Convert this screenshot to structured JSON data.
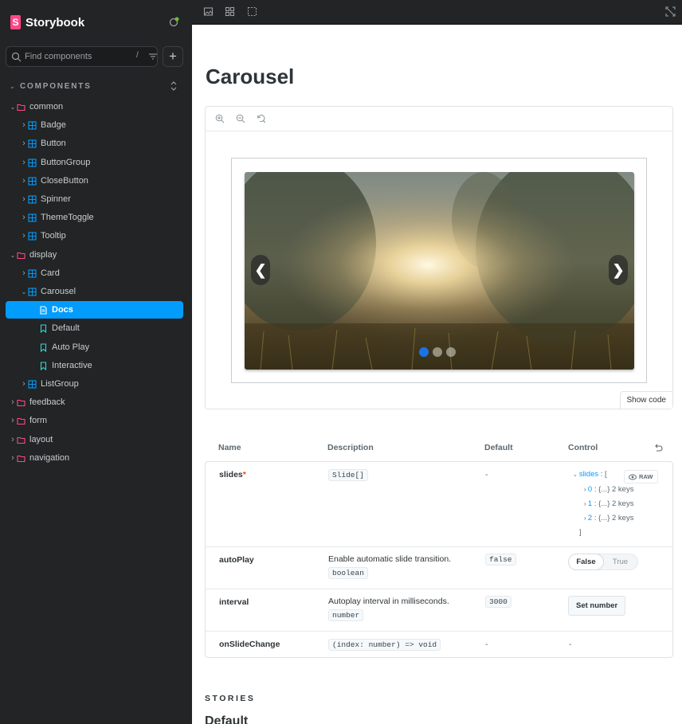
{
  "sidebar": {
    "brand": "Storybook",
    "search": {
      "placeholder": "Find components",
      "shortcut": "/"
    },
    "add_label": "+",
    "section_label": "COMPONENTS",
    "tree": [
      {
        "label": "common",
        "type": "folder",
        "expanded": true
      },
      {
        "label": "Badge",
        "type": "component"
      },
      {
        "label": "Button",
        "type": "component"
      },
      {
        "label": "ButtonGroup",
        "type": "component"
      },
      {
        "label": "CloseButton",
        "type": "component"
      },
      {
        "label": "Spinner",
        "type": "component"
      },
      {
        "label": "ThemeToggle",
        "type": "component"
      },
      {
        "label": "Tooltip",
        "type": "component"
      },
      {
        "label": "display",
        "type": "folder",
        "expanded": true
      },
      {
        "label": "Card",
        "type": "component"
      },
      {
        "label": "Carousel",
        "type": "component",
        "expanded": true
      },
      {
        "label": "Docs",
        "type": "docs",
        "selected": true
      },
      {
        "label": "Default",
        "type": "story"
      },
      {
        "label": "Auto Play",
        "type": "story"
      },
      {
        "label": "Interactive",
        "type": "story"
      },
      {
        "label": "ListGroup",
        "type": "component"
      },
      {
        "label": "feedback",
        "type": "folder"
      },
      {
        "label": "form",
        "type": "folder"
      },
      {
        "label": "layout",
        "type": "folder"
      },
      {
        "label": "navigation",
        "type": "folder"
      }
    ]
  },
  "toolbar": {
    "icons": [
      "image-icon",
      "grid-icon",
      "outline-icon",
      "fullscreen-icon"
    ]
  },
  "docs": {
    "title": "Carousel",
    "preview": {
      "zoom_icons": [
        "zoom-in-icon",
        "zoom-out-icon",
        "zoom-reset-icon"
      ],
      "prev_label": "❮",
      "next_label": "❯",
      "slide_count": 3,
      "active_slide": 0,
      "show_code": "Show code"
    },
    "args": {
      "headers": {
        "name": "Name",
        "description": "Description",
        "default": "Default",
        "control": "Control"
      },
      "rows": {
        "slides": {
          "name": "slides",
          "required_mark": "*",
          "type": "Slide[]",
          "default": "-",
          "control": {
            "key": "slides",
            "open": "[",
            "close": "]",
            "raw_label": "RAW",
            "items": [
              {
                "index": "0",
                "summary": "{...} 2 keys"
              },
              {
                "index": "1",
                "summary": "{...} 2 keys"
              },
              {
                "index": "2",
                "summary": "{...} 2 keys"
              }
            ]
          }
        },
        "autoPlay": {
          "name": "autoPlay",
          "description": "Enable automatic slide transition.",
          "type": "boolean",
          "default": "false",
          "control": {
            "false_label": "False",
            "true_label": "True",
            "value": false
          }
        },
        "interval": {
          "name": "interval",
          "description": "Autoplay interval in milliseconds.",
          "type": "number",
          "default": "3000",
          "control": {
            "label": "Set number"
          }
        },
        "onSlideChange": {
          "name": "onSlideChange",
          "type": "(index: number) => void",
          "default": "-",
          "control": "-"
        }
      }
    },
    "stories_label": "STORIES",
    "next_story_title": "Default"
  },
  "colors": {
    "sidebar_bg": "#222425",
    "selected": "#029cfd",
    "brand": "#ff4785",
    "folder_icon": "#ff4785",
    "component_icon": "#029cfd",
    "story_icon": "#37d5d3",
    "docs_icon": "#ffffff",
    "status_green": "#66bf3c",
    "dot_active": "#1a73e8"
  }
}
